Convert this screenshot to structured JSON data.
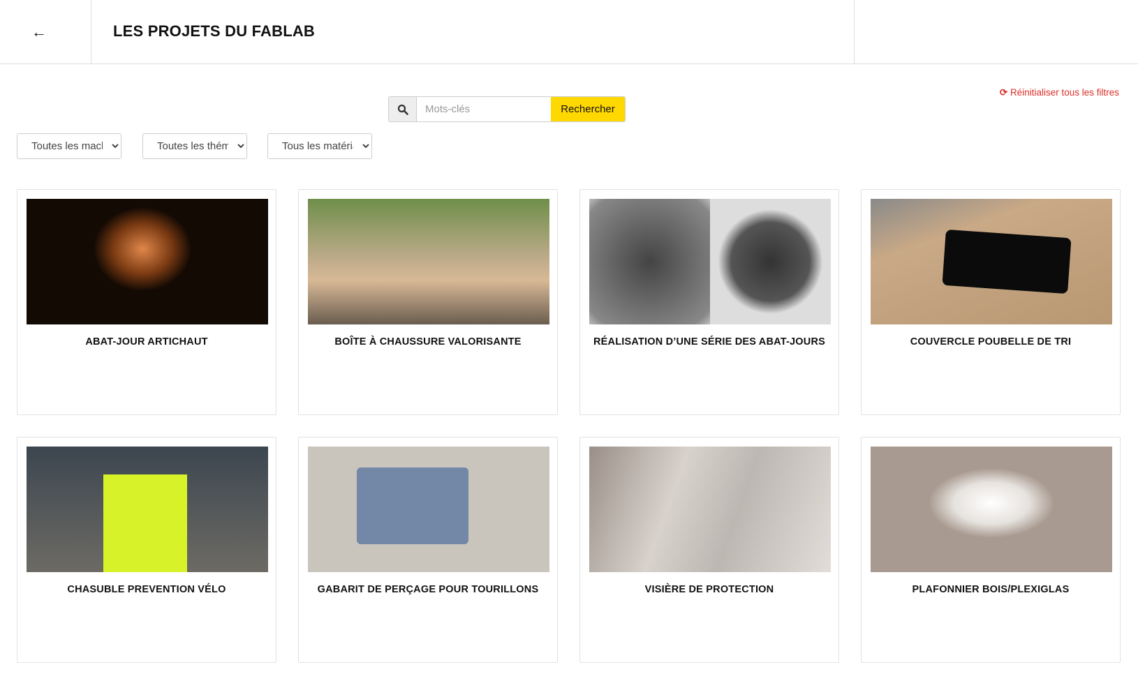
{
  "header": {
    "back_icon": "arrow-left-icon",
    "back_glyph": "←",
    "title": "LES PROJETS DU FABLAB"
  },
  "filters": {
    "reset_icon": "refresh-icon",
    "reset_label": "Réinitialiser tous les filtres",
    "search_icon": "search-icon",
    "search_placeholder": "Mots-clés",
    "search_value": "",
    "search_button": "Rechercher",
    "selects": [
      {
        "value": "Toutes les machines"
      },
      {
        "value": "Toutes les thématiques"
      },
      {
        "value": "Tous les matériaux"
      }
    ]
  },
  "accent": "#ffd800",
  "reset_color": "#d9302a",
  "projects": [
    {
      "title": "ABAT-JOUR ARTICHAUT"
    },
    {
      "title": "BOÎTE À CHAUSSURE VALORISANTE"
    },
    {
      "title": "RÉALISATION D’UNE SÉRIE DES ABAT-JOURS"
    },
    {
      "title": "COUVERCLE POUBELLE DE TRI"
    },
    {
      "title": "CHASUBLE PREVENTION VÉLO"
    },
    {
      "title": "GABARIT DE PERÇAGE POUR TOURILLONS"
    },
    {
      "title": "VISIÈRE DE PROTECTION"
    },
    {
      "title": "PLAFONNIER BOIS/PLEXIGLAS"
    }
  ]
}
